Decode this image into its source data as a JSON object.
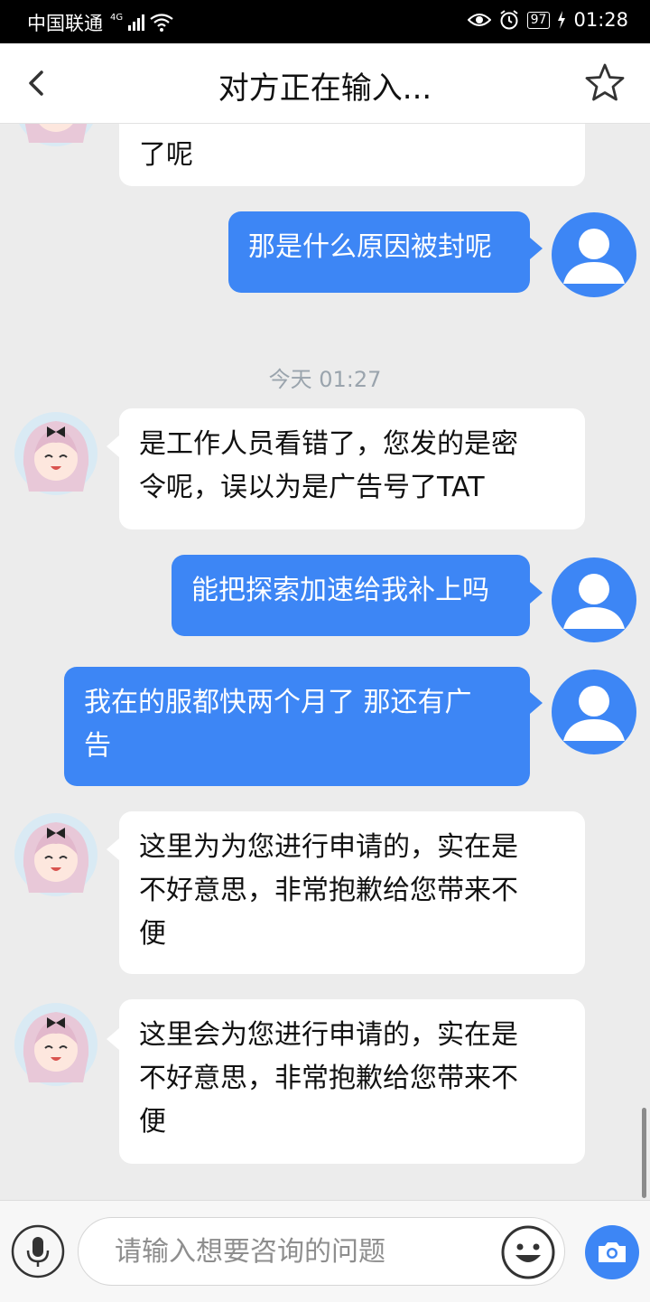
{
  "status_bar": {
    "carrier": "中国联通",
    "network": "4G",
    "battery": "97",
    "time": "01:28"
  },
  "header": {
    "title": "对方正在输入..."
  },
  "chat": {
    "timestamp": "今天 01:27",
    "messages": [
      {
        "side": "in",
        "text": "了呢"
      },
      {
        "side": "out",
        "text": "那是什么原因被封呢"
      },
      {
        "side": "in",
        "text": "是工作人员看错了，您发的是密\n令呢，误以为是广告号了TAT"
      },
      {
        "side": "out",
        "text": "能把探索加速给我补上吗"
      },
      {
        "side": "out",
        "text": "我在的服都快两个月了 那还有广\n告"
      },
      {
        "side": "in",
        "text": "这里为为您进行申请的，实在是\n不好意思，非常抱歉给您带来不\n便"
      },
      {
        "side": "in",
        "text": "这里会为您进行申请的，实在是\n不好意思，非常抱歉给您带来不\n便"
      }
    ]
  },
  "input_bar": {
    "placeholder": "请输入想要咨询的问题"
  },
  "colors": {
    "accent": "#3d86f5",
    "background": "#ececec"
  },
  "icons": {
    "back": "chevron-left-icon",
    "favorite": "star-icon",
    "voice": "microphone-icon",
    "emoji": "smiley-icon",
    "camera": "camera-icon"
  }
}
